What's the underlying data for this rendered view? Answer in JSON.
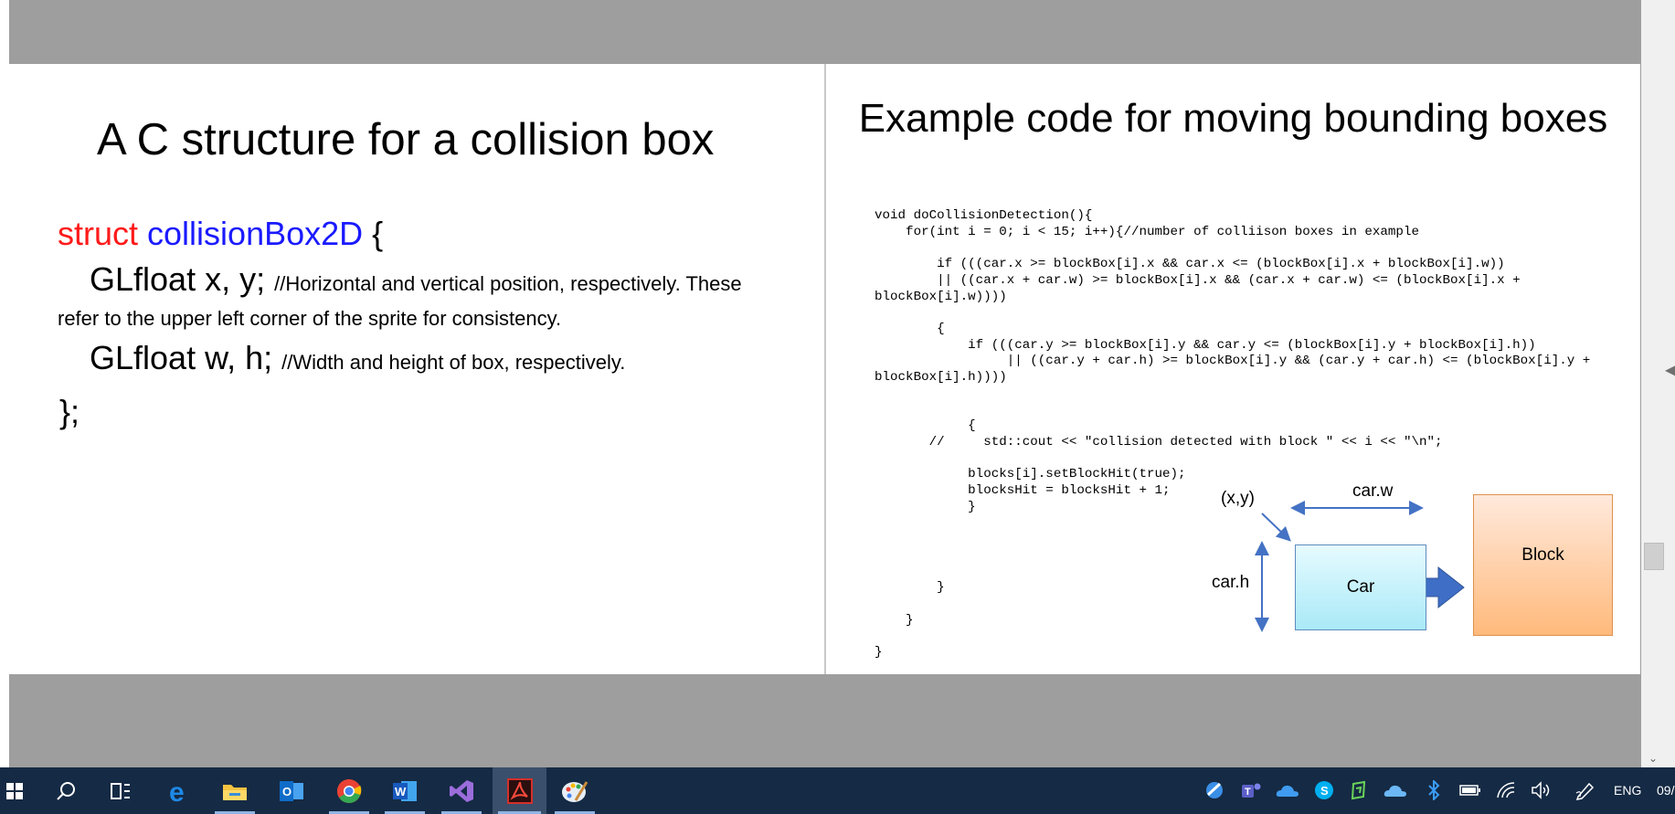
{
  "left_slide": {
    "title": "A  C structure for a collision box",
    "struct_keyword": "struct",
    "struct_name": "collisionBox2D",
    "open_brace": "{",
    "field1_decl": "GLfloat x, y;",
    "field1_comment": "//Horizontal  and vertical position, respectively.  These",
    "field1_comment_wrap": "refer to the upper left corner of the sprite for consistency.",
    "field2_decl": "GLfloat w, h;",
    "field2_comment": "//Width and height of box, respectively.",
    "close_brace": "};",
    "colors": {
      "keyword": "#ff1a1a",
      "type_name": "#1a1aff"
    }
  },
  "right_slide": {
    "title": "Example code for moving bounding boxes",
    "code": "void doCollisionDetection(){\n    for(int i = 0; i < 15; i++){//number of colliison boxes in example\n\n        if (((car.x >= blockBox[i].x && car.x <= (blockBox[i].x + blockBox[i].w))\n        || ((car.x + car.w) >= blockBox[i].x && (car.x + car.w) <= (blockBox[i].x +\nblockBox[i].w))))\n\n        {\n            if (((car.y >= blockBox[i].y && car.y <= (blockBox[i].y + blockBox[i].h))\n                 || ((car.y + car.h) >= blockBox[i].y && (car.y + car.h) <= (blockBox[i].y +\nblockBox[i].h))))\n\n\n            {\n       //     std::cout << \"collision detected with block \" << i << \"\\n\";\n\n            blocks[i].setBlockHit(true);\n            blocksHit = blocksHit + 1;\n            }\n\n\n\n\n        }\n\n    }\n\n}",
    "diagram": {
      "xy_label": "(x,y)",
      "width_label": "car.w",
      "height_label": "car.h",
      "car_label": "Car",
      "block_label": "Block",
      "colors": {
        "arrow": "#4472c4",
        "car_fill": "#a9e9f7",
        "block_fill": "#ffba7c"
      }
    }
  },
  "taskbar": {
    "apps": [
      "start-icon",
      "search-icon",
      "task-view-icon",
      "edge-icon",
      "file-explorer-icon",
      "outlook-icon",
      "chrome-icon",
      "word-icon",
      "visual-studio-icon",
      "acrobat-icon",
      "paint-icon"
    ],
    "language": "ENG",
    "clock": "09/"
  }
}
